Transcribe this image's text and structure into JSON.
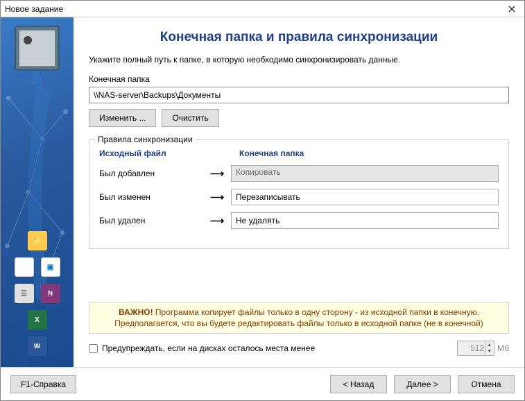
{
  "window": {
    "title": "Новое задание"
  },
  "page": {
    "title": "Конечная папка и правила синхронизации",
    "subtitle": "Укажите полный путь к папке, в которую необходимо синхронизировать данные.",
    "dest_label": "Конечная папка",
    "dest_path": "\\\\NAS-server\\Backups\\Документы",
    "change_btn": "Изменить ...",
    "clear_btn": "Очистить"
  },
  "rules": {
    "legend": "Правила синхронизации",
    "h_source": "Исходный файл",
    "h_dest": "Конечная папка",
    "rows": [
      {
        "label": "Был добавлен",
        "value": "Копировать",
        "disabled": true
      },
      {
        "label": "Был изменен",
        "value": "Перезаписывать",
        "disabled": false
      },
      {
        "label": "Был удален",
        "value": "Не удалять",
        "disabled": false
      }
    ]
  },
  "warning": {
    "l1_strong": "ВАЖНО!",
    "l1_rest": " Программа копирует файлы только в одну сторону - из исходной папки в конечную.",
    "l2": "Предполагается, что вы будете редактировать файлы только в исходной папке (не в конечной)"
  },
  "disk": {
    "check_label": "Предупреждать, если на дисках осталось места менее",
    "value": "512",
    "unit": "Мб"
  },
  "footer": {
    "help": "F1-Справка",
    "back": "< Назад",
    "next": "Далее >",
    "cancel": "Отмена"
  },
  "icons": {
    "word": "W",
    "excel": "X",
    "onenote": "N",
    "contact": "☰",
    "image": "▣",
    "binder": "▤",
    "folder": "📁"
  }
}
